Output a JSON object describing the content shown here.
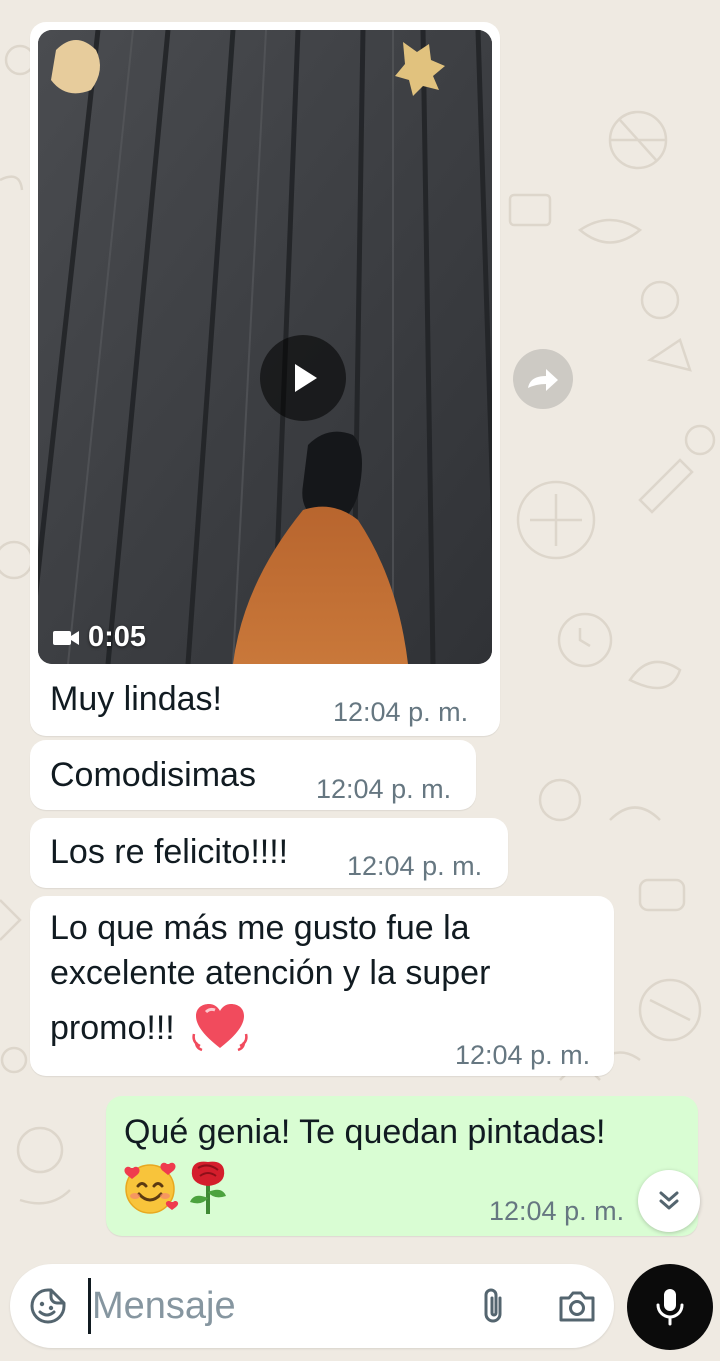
{
  "conversation": {
    "video_message": {
      "duration": "0:05",
      "media_icon": "videocam-icon"
    },
    "incoming_messages": [
      {
        "text": "Muy lindas!",
        "time": "12:04 p. m."
      },
      {
        "text": "Comodisimas",
        "time": "12:04 p. m."
      },
      {
        "text": "Los re felicito!!!!",
        "time": "12:04 p. m."
      },
      {
        "lines": [
          "Lo que más me gusto fue la",
          "excelente atención y la super",
          "promo!!!"
        ],
        "emoji": "heart-emoji",
        "time": "12:04 p. m."
      }
    ],
    "outgoing_message": {
      "text": "Qué genia! Te quedan pintadas!",
      "emojis": [
        "smiling-face-with-hearts-emoji",
        "rose-emoji"
      ],
      "time": "12:04 p. m."
    }
  },
  "composer": {
    "placeholder": "Mensaje",
    "icons": [
      "sticker-icon",
      "attach-icon",
      "camera-icon",
      "mic-icon"
    ]
  },
  "colors": {
    "chat_background": "#efeae2",
    "incoming_bubble": "#ffffff",
    "outgoing_bubble": "#d9fdd3",
    "timestamp": "#667781",
    "mic_button": "#0b0b0b"
  }
}
